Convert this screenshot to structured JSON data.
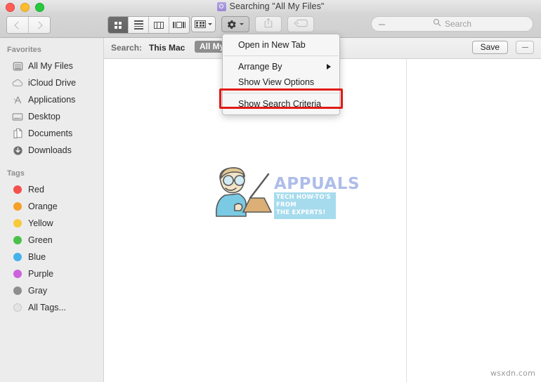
{
  "window": {
    "title": "Searching \"All My Files\"",
    "title_icon": "purple-search-folder-icon",
    "traffic_lights": [
      {
        "name": "close",
        "color": "#ff5f57"
      },
      {
        "name": "minimize",
        "color": "#ffbd2e"
      },
      {
        "name": "maximize",
        "color": "#28c940"
      }
    ]
  },
  "toolbar": {
    "back_icon": "chevron-left-icon",
    "forward_icon": "chevron-right-icon",
    "view_modes": [
      {
        "name": "icon-view",
        "icon": "grid-icon",
        "active": true
      },
      {
        "name": "list-view",
        "icon": "list-icon",
        "active": false
      },
      {
        "name": "column-view",
        "icon": "columns-icon",
        "active": false
      },
      {
        "name": "coverflow-view",
        "icon": "coverflow-icon",
        "active": false
      }
    ],
    "arrange_icon": "arrange-grid-icon",
    "gear_icon": "gear-icon",
    "share_icon": "share-up-arrow-icon",
    "tag_icon": "tag-icon"
  },
  "search": {
    "placeholder": "Search",
    "value": "",
    "icon": "search-icon",
    "reset_icon": "reset-dash-icon"
  },
  "criteria": {
    "label": "Search:",
    "scopes": [
      {
        "label": "This Mac",
        "selected": false
      },
      {
        "label": "All My Files",
        "selected": true
      }
    ],
    "save_label": "Save",
    "remove_icon": "minus-icon"
  },
  "sidebar": {
    "sections": [
      {
        "header": "Favorites",
        "items": [
          {
            "label": "All My Files",
            "icon": "all-my-files-icon"
          },
          {
            "label": "iCloud Drive",
            "icon": "icloud-icon"
          },
          {
            "label": "Applications",
            "icon": "applications-icon"
          },
          {
            "label": "Desktop",
            "icon": "desktop-icon"
          },
          {
            "label": "Documents",
            "icon": "documents-icon"
          },
          {
            "label": "Downloads",
            "icon": "downloads-icon"
          }
        ]
      },
      {
        "header": "Tags",
        "items": [
          {
            "label": "Red",
            "icon": "tag-dot-icon",
            "color": "#f4504c"
          },
          {
            "label": "Orange",
            "icon": "tag-dot-icon",
            "color": "#f5a028"
          },
          {
            "label": "Yellow",
            "icon": "tag-dot-icon",
            "color": "#f7ca3c"
          },
          {
            "label": "Green",
            "icon": "tag-dot-icon",
            "color": "#4cc04c"
          },
          {
            "label": "Blue",
            "icon": "tag-dot-icon",
            "color": "#44b3ec"
          },
          {
            "label": "Purple",
            "icon": "tag-dot-icon",
            "color": "#cc63dd"
          },
          {
            "label": "Gray",
            "icon": "tag-dot-icon",
            "color": "#8e8e8e"
          },
          {
            "label": "All Tags...",
            "icon": "tag-dot-hollow-icon",
            "color": "#e4e4e4"
          }
        ]
      }
    ]
  },
  "context_menu": {
    "items": [
      {
        "label": "Open in New Tab",
        "has_submenu": false
      },
      {
        "label": "Arrange By",
        "has_submenu": true
      },
      {
        "label": "Show View Options",
        "has_submenu": false
      },
      {
        "label": "Show Search Criteria",
        "has_submenu": false,
        "highlighted": true
      }
    ],
    "highlight_color": "#e01b14"
  },
  "watermark": {
    "brand": "APPUALS",
    "tagline_line1": "TECH HOW-TO'S FROM",
    "tagline_line2": "THE EXPERTS!",
    "brand_color": "#a8b8e8",
    "tagline_bg": "#9fd8ec",
    "bottom_right": "wsxdn.com"
  }
}
